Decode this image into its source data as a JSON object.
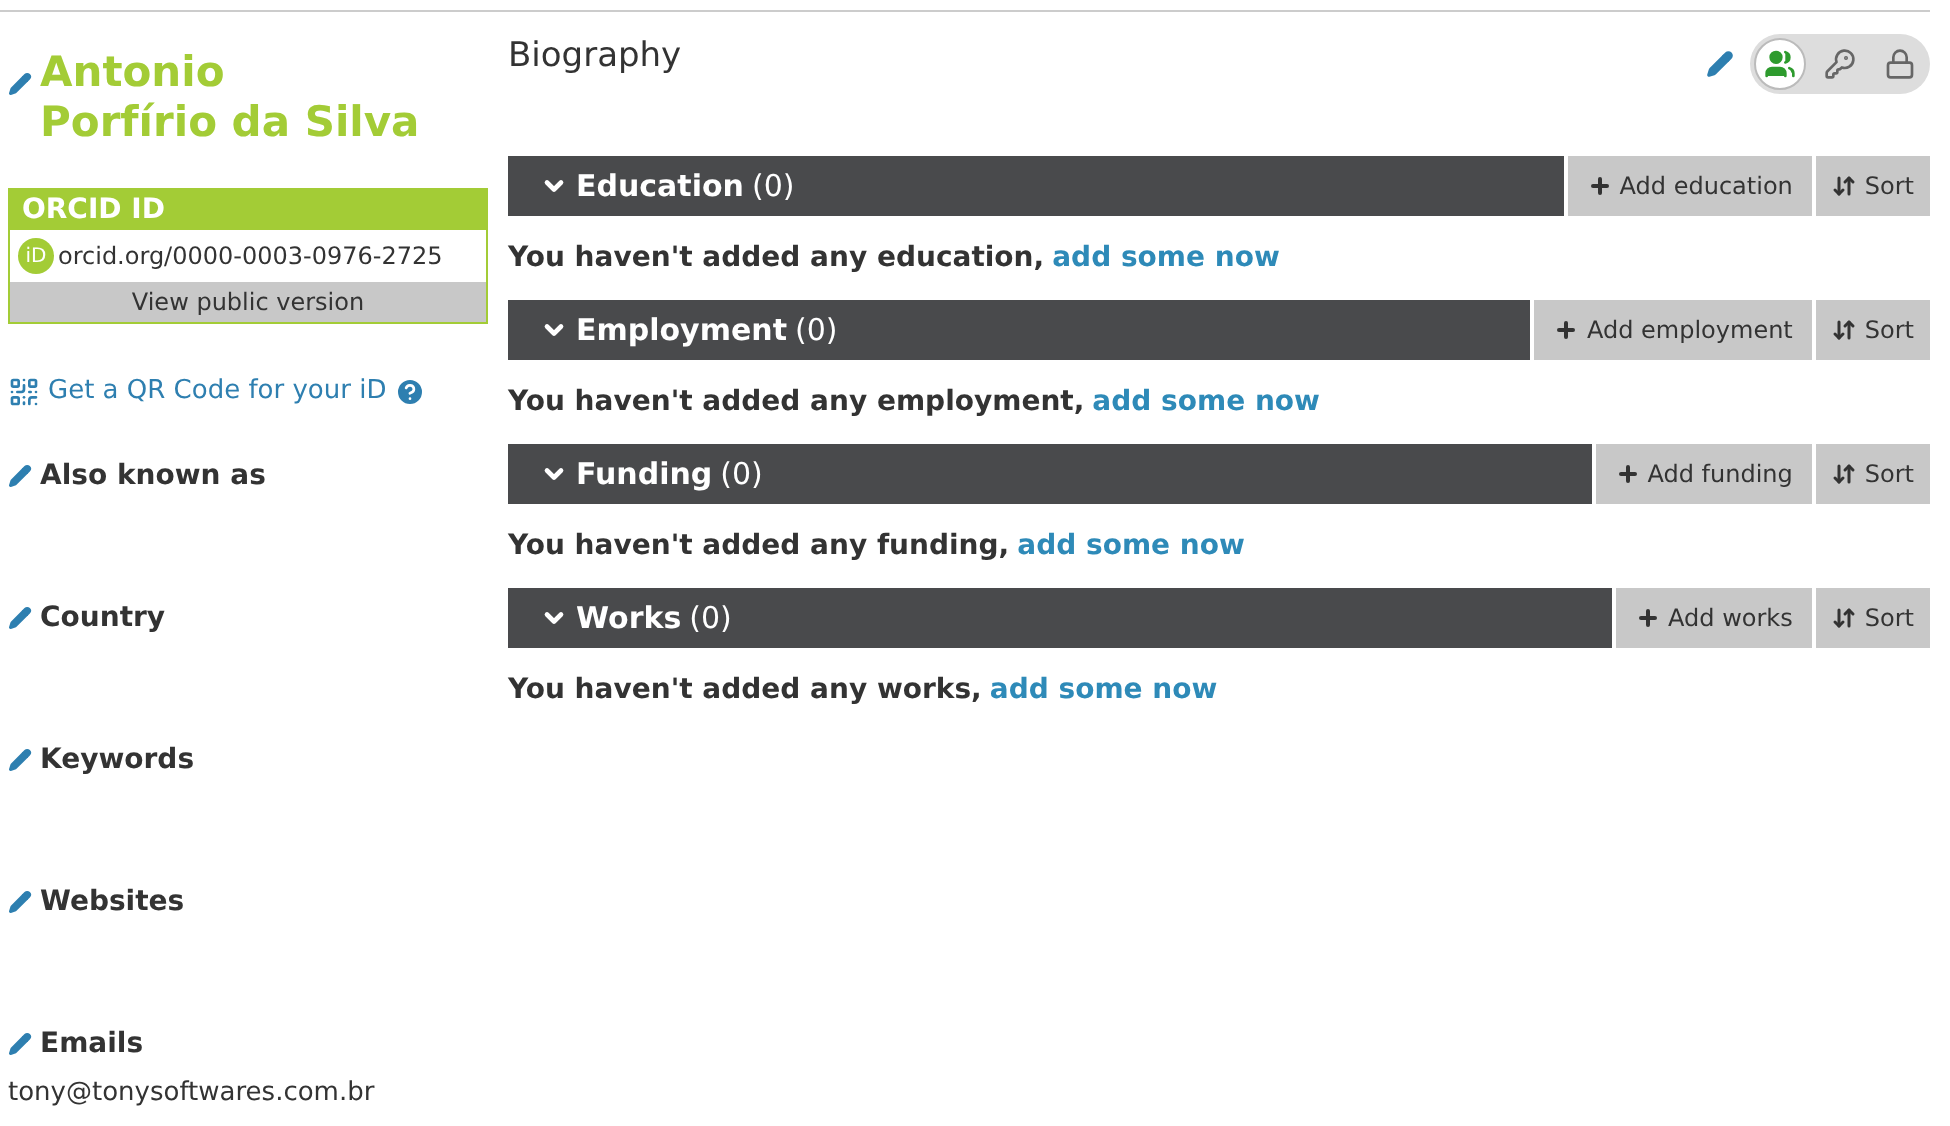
{
  "profile": {
    "name_line1": "Antonio",
    "name_line2": "Porfírio da Silva"
  },
  "orcid": {
    "heading": "ORCID ID",
    "id_badge": "iD",
    "id": "orcid.org/0000-0003-0976-2725",
    "public_link": "View public version"
  },
  "qr_link": "Get a QR Code for your iD",
  "sidebar_fields": [
    {
      "label": "Also known as"
    },
    {
      "label": "Country"
    },
    {
      "label": "Keywords"
    },
    {
      "label": "Websites"
    },
    {
      "label": "Emails",
      "value": "tony@tonysoftwares.com.br"
    }
  ],
  "biography": {
    "title": "Biography",
    "privacy": [
      {
        "kind": "everyone",
        "selected": true
      },
      {
        "kind": "trusted",
        "selected": false
      },
      {
        "kind": "private",
        "selected": false
      }
    ]
  },
  "sections": [
    {
      "title": "Education",
      "count": "(0)",
      "add_label": "Add education",
      "sort_label": "Sort",
      "message": "You haven't added any education,",
      "link": "add some now"
    },
    {
      "title": "Employment",
      "count": "(0)",
      "add_label": "Add employment",
      "sort_label": "Sort",
      "message": "You haven't added any employment,",
      "link": "add some now"
    },
    {
      "title": "Funding",
      "count": "(0)",
      "add_label": "Add funding",
      "sort_label": "Sort",
      "message": "You haven't added any funding,",
      "link": "add some now"
    },
    {
      "title": "Works",
      "count": "(0)",
      "add_label": "Add works",
      "sort_label": "Sort",
      "message": "You haven't added any works,",
      "link": "add some now"
    }
  ]
}
